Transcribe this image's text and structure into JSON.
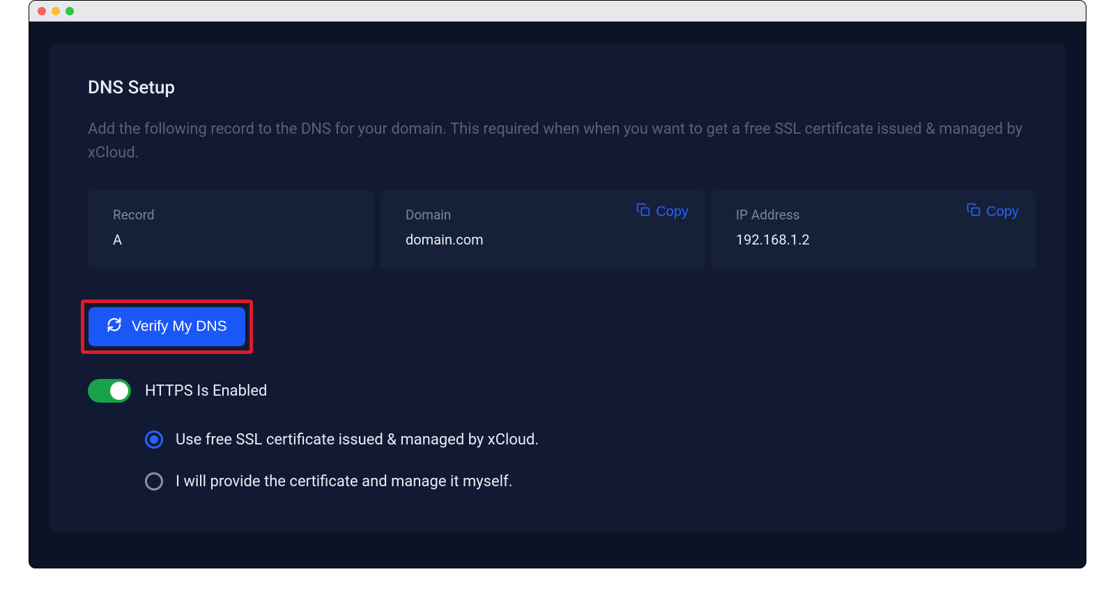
{
  "header": {
    "title": "DNS Setup",
    "description": "Add the following record to the DNS for your domain. This required when when you want to get a free SSL certificate issued & managed by xCloud."
  },
  "dns": {
    "record": {
      "label": "Record",
      "value": "A"
    },
    "domain": {
      "label": "Domain",
      "value": "domain.com",
      "copy_label": "Copy"
    },
    "ip": {
      "label": "IP Address",
      "value": "192.168.1.2",
      "copy_label": "Copy"
    }
  },
  "actions": {
    "verify_label": "Verify My DNS"
  },
  "https": {
    "enabled_label": "HTTPS Is Enabled",
    "enabled": true
  },
  "ssl_options": {
    "selected": 0,
    "options": [
      {
        "label": "Use free SSL certificate issued & managed by xCloud."
      },
      {
        "label": "I will provide the certificate and manage it myself."
      }
    ]
  },
  "colors": {
    "accent": "#1b56f6",
    "success": "#17a34a",
    "highlight_border": "#dd1a2b"
  }
}
